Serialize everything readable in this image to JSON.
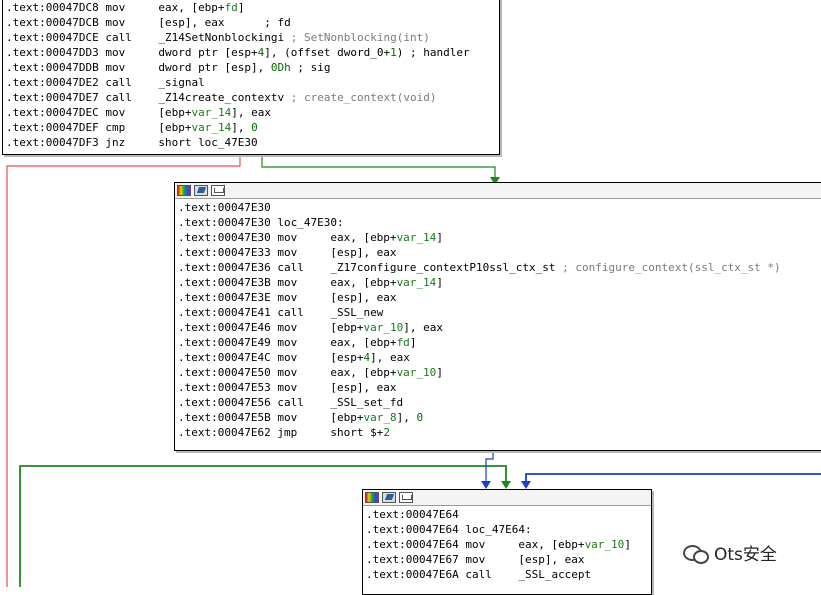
{
  "blocks": [
    {
      "id": "block1",
      "lines": [
        {
          "addr": ".text:00047DC8",
          "mn": "mov",
          "ops": [
            {
              "t": "eax, [ebp+"
            },
            {
              "t": "fd",
              "k": "v"
            },
            {
              "t": "]"
            }
          ]
        },
        {
          "addr": ".text:00047DCB",
          "mn": "mov",
          "ops": [
            {
              "t": "[esp], eax      "
            },
            {
              "t": "; fd",
              "k": "c2"
            }
          ]
        },
        {
          "addr": ".text:00047DCE",
          "mn": "call",
          "ops": [
            {
              "t": "_Z14SetNonblockingi "
            },
            {
              "t": "; SetNonblocking(int)",
              "k": "c"
            }
          ]
        },
        {
          "addr": ".text:00047DD3",
          "mn": "mov",
          "ops": [
            {
              "t": "dword ptr [esp+"
            },
            {
              "t": "4",
              "k": "n"
            },
            {
              "t": "], (offset dword_0+"
            },
            {
              "t": "1",
              "k": "n"
            },
            {
              "t": ") ; handler"
            }
          ]
        },
        {
          "addr": ".text:00047DDB",
          "mn": "mov",
          "ops": [
            {
              "t": "dword ptr [esp], "
            },
            {
              "t": "0Dh",
              "k": "n"
            },
            {
              "t": " ; sig"
            }
          ]
        },
        {
          "addr": ".text:00047DE2",
          "mn": "call",
          "ops": [
            {
              "t": "_signal"
            }
          ]
        },
        {
          "addr": ".text:00047DE7",
          "mn": "call",
          "ops": [
            {
              "t": "_Z14create_contextv "
            },
            {
              "t": "; create_context(void)",
              "k": "c"
            }
          ]
        },
        {
          "addr": ".text:00047DEC",
          "mn": "mov",
          "ops": [
            {
              "t": "[ebp+"
            },
            {
              "t": "var_14",
              "k": "v"
            },
            {
              "t": "], eax"
            }
          ]
        },
        {
          "addr": ".text:00047DEF",
          "mn": "cmp",
          "ops": [
            {
              "t": "[ebp+"
            },
            {
              "t": "var_14",
              "k": "v"
            },
            {
              "t": "], "
            },
            {
              "t": "0",
              "k": "n"
            }
          ]
        },
        {
          "addr": ".text:00047DF3",
          "mn": "jnz",
          "ops": [
            {
              "t": "short loc_47E30"
            }
          ]
        }
      ]
    },
    {
      "id": "block2",
      "lines": [
        {
          "addr": ".text:00047E30",
          "mn": "",
          "ops": []
        },
        {
          "addr": ".text:00047E30",
          "label": "loc_47E30:"
        },
        {
          "addr": ".text:00047E30",
          "mn": "mov",
          "ops": [
            {
              "t": "eax, [ebp+"
            },
            {
              "t": "var_14",
              "k": "v"
            },
            {
              "t": "]"
            }
          ]
        },
        {
          "addr": ".text:00047E33",
          "mn": "mov",
          "ops": [
            {
              "t": "[esp], eax"
            }
          ]
        },
        {
          "addr": ".text:00047E36",
          "mn": "call",
          "ops": [
            {
              "t": "_Z17configure_contextP10ssl_ctx_st "
            },
            {
              "t": "; configure_context(ssl_ctx_st *)",
              "k": "c"
            }
          ]
        },
        {
          "addr": ".text:00047E3B",
          "mn": "mov",
          "ops": [
            {
              "t": "eax, [ebp+"
            },
            {
              "t": "var_14",
              "k": "v"
            },
            {
              "t": "]"
            }
          ]
        },
        {
          "addr": ".text:00047E3E",
          "mn": "mov",
          "ops": [
            {
              "t": "[esp], eax"
            }
          ]
        },
        {
          "addr": ".text:00047E41",
          "mn": "call",
          "ops": [
            {
              "t": "_SSL_new"
            }
          ]
        },
        {
          "addr": ".text:00047E46",
          "mn": "mov",
          "ops": [
            {
              "t": "[ebp+"
            },
            {
              "t": "var_10",
              "k": "v"
            },
            {
              "t": "], eax"
            }
          ]
        },
        {
          "addr": ".text:00047E49",
          "mn": "mov",
          "ops": [
            {
              "t": "eax, [ebp+"
            },
            {
              "t": "fd",
              "k": "v"
            },
            {
              "t": "]"
            }
          ]
        },
        {
          "addr": ".text:00047E4C",
          "mn": "mov",
          "ops": [
            {
              "t": "[esp+"
            },
            {
              "t": "4",
              "k": "n"
            },
            {
              "t": "], eax"
            }
          ]
        },
        {
          "addr": ".text:00047E50",
          "mn": "mov",
          "ops": [
            {
              "t": "eax, [ebp+"
            },
            {
              "t": "var_10",
              "k": "v"
            },
            {
              "t": "]"
            }
          ]
        },
        {
          "addr": ".text:00047E53",
          "mn": "mov",
          "ops": [
            {
              "t": "[esp], eax"
            }
          ]
        },
        {
          "addr": ".text:00047E56",
          "mn": "call",
          "ops": [
            {
              "t": "_SSL_set_fd"
            }
          ]
        },
        {
          "addr": ".text:00047E5B",
          "mn": "mov",
          "ops": [
            {
              "t": "[ebp+"
            },
            {
              "t": "var_8",
              "k": "v"
            },
            {
              "t": "], "
            },
            {
              "t": "0",
              "k": "n"
            }
          ]
        },
        {
          "addr": ".text:00047E62",
          "mn": "jmp",
          "ops": [
            {
              "t": "short $+"
            },
            {
              "t": "2",
              "k": "n"
            }
          ]
        }
      ]
    },
    {
      "id": "block3",
      "lines": [
        {
          "addr": ".text:00047E64",
          "mn": "",
          "ops": []
        },
        {
          "addr": ".text:00047E64",
          "label": "loc_47E64:"
        },
        {
          "addr": ".text:00047E64",
          "mn": "mov",
          "ops": [
            {
              "t": "eax, [ebp+"
            },
            {
              "t": "var_10",
              "k": "v"
            },
            {
              "t": "]"
            }
          ]
        },
        {
          "addr": ".text:00047E67",
          "mn": "mov",
          "ops": [
            {
              "t": "[esp], eax"
            }
          ]
        },
        {
          "addr": ".text:00047E6A",
          "mn": "call",
          "ops": [
            {
              "t": "_SSL_accept"
            }
          ]
        }
      ]
    }
  ],
  "colors": {
    "edge_false": "#e05050",
    "edge_true": "#1a8a1a",
    "edge_uncond": "#1a3fd0"
  },
  "icons": [
    "palette-icon",
    "edit-icon",
    "graph-icon"
  ],
  "watermark": {
    "text": "Ots安全",
    "icon": "wechat-icon"
  }
}
